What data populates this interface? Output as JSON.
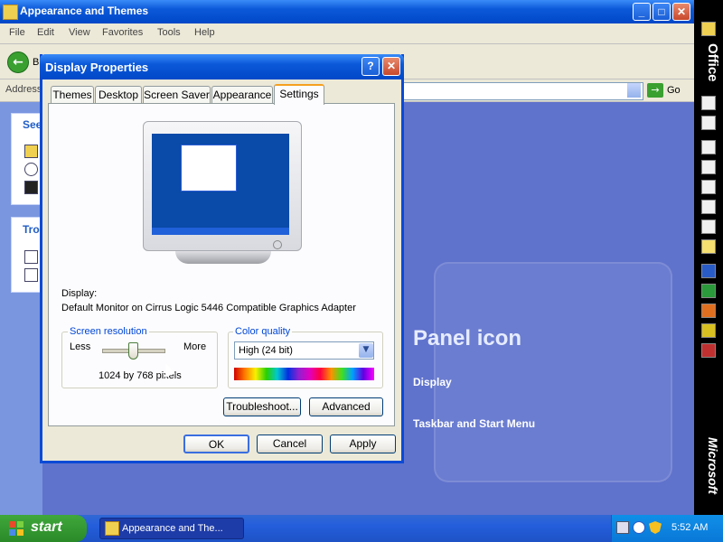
{
  "explorer": {
    "title": "Appearance and Themes",
    "menu": [
      "File",
      "Edit",
      "View",
      "Favorites",
      "Tools",
      "Help"
    ],
    "back_label": "B",
    "address_label": "Address",
    "go_label": "Go",
    "see_also_title": "See",
    "troubleshooters_title": "Tro",
    "panel_icon_heading": "Panel icon",
    "links": [
      "Display",
      "Taskbar and Start Menu"
    ]
  },
  "dialog": {
    "title": "Display Properties",
    "tabs": [
      "Themes",
      "Desktop",
      "Screen Saver",
      "Appearance",
      "Settings"
    ],
    "active_tab": "Settings",
    "display_label": "Display:",
    "display_device": "Default Monitor on Cirrus Logic 5446 Compatible Graphics Adapter",
    "resolution": {
      "legend": "Screen resolution",
      "less": "Less",
      "more": "More",
      "value": "1024 by 768 pixels",
      "slider_level": 0.5
    },
    "color_quality": {
      "legend": "Color quality",
      "selected": "High (24 bit)"
    },
    "buttons": {
      "troubleshoot": "Troubleshoot...",
      "advanced": "Advanced",
      "ok": "OK",
      "cancel": "Cancel",
      "apply": "Apply"
    }
  },
  "office_bar": {
    "top_label": "Office",
    "bottom_label": "Microsoft"
  },
  "taskbar": {
    "start_label": "start",
    "task_item": "Appearance and The...",
    "clock": "5:52 AM"
  },
  "colors": {
    "xp_blue": "#0b58d8",
    "start_green": "#3fa83b",
    "content_bg": "#5f72cc"
  }
}
